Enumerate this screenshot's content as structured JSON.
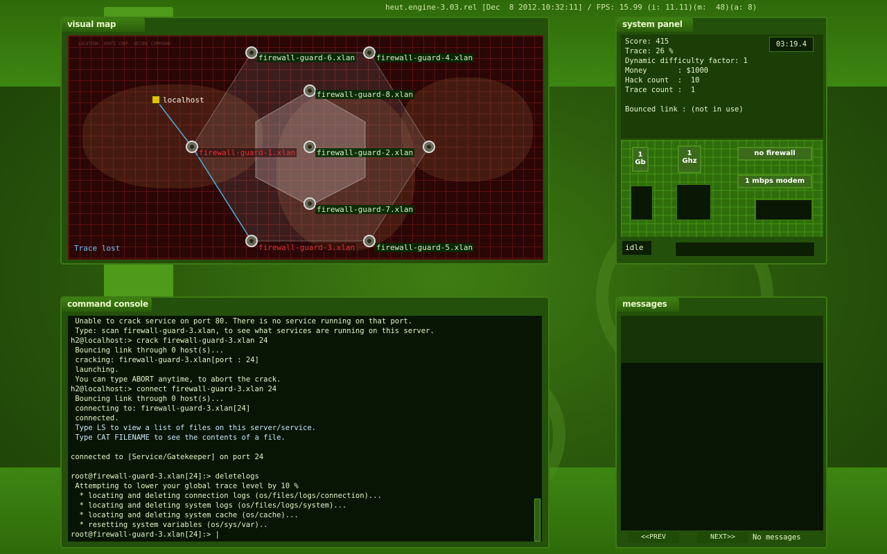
{
  "header": {
    "engine_info": "heut.engine-3.03.rel [Dec  8 2012.10:32:11] / FPS: 15.99 (i: 11.11)(m:  48)(a: 8)"
  },
  "visual_map": {
    "title": "visual map",
    "location": "LOCATION: XENTI CORP. SECURE COMPOUND",
    "status": "Trace lost",
    "nodes": [
      {
        "label": "localhost",
        "style": "home"
      },
      {
        "label": "firewall-guard-6.xlan",
        "style": "normal"
      },
      {
        "label": "firewall-guard-4.xlan",
        "style": "normal"
      },
      {
        "label": "firewall-guard-8.xlan",
        "style": "normal"
      },
      {
        "label": "firewall-guard-1.xlan",
        "style": "red"
      },
      {
        "label": "firewall-guard-2.xlan",
        "style": "normal"
      },
      {
        "label": "firewall-guard-7.xlan",
        "style": "normal"
      },
      {
        "label": "firewall-guard-3.xlan",
        "style": "red"
      },
      {
        "label": "firewall-guard-5.xlan",
        "style": "normal"
      }
    ]
  },
  "system_panel": {
    "title": "system panel",
    "timer": "03:19.4",
    "lines": [
      "Score: 415",
      "Trace: 26 %",
      "Dynamic difficulty factor: 1",
      "Money       : $1000",
      "Hack count  :  10",
      "Trace count :  1",
      "",
      "Bounced link : (not in use)"
    ],
    "hardware": {
      "memory": "1 Gb",
      "cpu": "1 Ghz",
      "firewall": "no firewall",
      "modem": "1 mbps modem"
    },
    "status": "idle"
  },
  "command_console": {
    "title": "command console",
    "lines": [
      {
        "text": " Unable to crack service on port 80. There is no service running on that port.",
        "kind": "out"
      },
      {
        "text": " Type: scan firewall-guard-3.xlan, to see what services are running on this server.",
        "kind": "out"
      },
      {
        "text": "h2@localhost:> crack firewall-guard-3.xlan 24",
        "kind": "cmd"
      },
      {
        "text": " Bouncing link through 0 host(s)...",
        "kind": "out"
      },
      {
        "text": " cracking: firewall-guard-3.xlan[port : 24]",
        "kind": "out"
      },
      {
        "text": " launching.",
        "kind": "out"
      },
      {
        "text": " You can type ABORT anytime, to abort the crack.",
        "kind": "out"
      },
      {
        "text": "h2@localhost:> connect firewall-guard-3.xlan 24",
        "kind": "cmd"
      },
      {
        "text": " Bouncing link through 0 host(s)...",
        "kind": "out"
      },
      {
        "text": " connecting to: firewall-guard-3.xlan[24]",
        "kind": "out"
      },
      {
        "text": " connected.",
        "kind": "out"
      },
      {
        "text": " Type LS to view a list of files on this server/service.",
        "kind": "info"
      },
      {
        "text": " Type CAT FILENAME to see the contents of a file.",
        "kind": "info"
      },
      {
        "text": "",
        "kind": "out"
      },
      {
        "text": "connected to [Service/Gatekeeper] on port 24",
        "kind": "out"
      },
      {
        "text": "",
        "kind": "out"
      },
      {
        "text": "root@firewall-guard-3.xlan[24]:> deletelogs",
        "kind": "cmd"
      },
      {
        "text": " Attempting to lower your global trace level by 10 %",
        "kind": "out"
      },
      {
        "text": "  * locating and deleting connection logs (os/files/logs/connection)...",
        "kind": "out"
      },
      {
        "text": "  * locating and deleting system logs (os/files/logs/system)...",
        "kind": "out"
      },
      {
        "text": "  * locating and deleting system cache (os/cache)...",
        "kind": "out"
      },
      {
        "text": "  * resetting system variables (os/sys/var)..",
        "kind": "out"
      },
      {
        "text": "root@firewall-guard-3.xlan[24]:> |",
        "kind": "cmd"
      }
    ]
  },
  "messages": {
    "title": "messages",
    "prev_label": "<<PREV",
    "next_label": "NEXT>>",
    "empty_text": "No messages"
  },
  "colors": {
    "accent_green": "#3d7a14",
    "trace_line": "#4ab0e0",
    "danger_red": "#e83030"
  }
}
